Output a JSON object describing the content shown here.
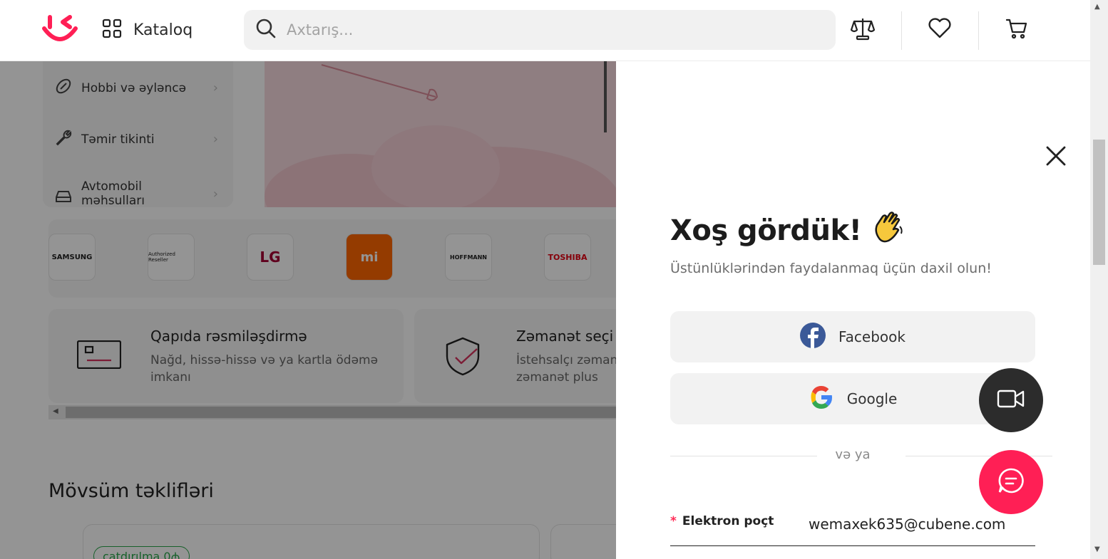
{
  "header": {
    "catalog_label": "Kataloq",
    "search_placeholder": "Axtarış..."
  },
  "background": {
    "categories": [
      {
        "label": "Hobbi və əyləncə"
      },
      {
        "label": "Təmir tikinti"
      },
      {
        "label": "Avtomobil məhsulları"
      }
    ],
    "brands": [
      "SAMSUNG",
      "Authorized Reseller",
      "LG",
      "mi",
      "HOFFMANN",
      "TOSHIBA"
    ],
    "features": [
      {
        "title": "Qapıda rəsmiləşdirmə",
        "desc": "Nağd, hissə-hissə və ya kartla ödəmə imkanı"
      },
      {
        "title": "Zəmanət seçi",
        "desc": "İstehsalçı zəman zəmanət plus"
      }
    ],
    "section_title": "Mövsüm təklifləri",
    "card_pill": "çatdırılma 0₼"
  },
  "login": {
    "title": "Xoş gördük!",
    "emoji": "👋",
    "subtitle": "Üstünlüklərindən faydalanmaq üçün daxil olun!",
    "facebook_label": "Facebook",
    "google_label": "Google",
    "divider_text": "və ya",
    "email_required_mark": "*",
    "email_label": "Elektron poçt",
    "email_value": "wemaxek635@cubene.com"
  },
  "colors": {
    "brand": "#ff1f55",
    "facebook": "#3b5998",
    "dark_fab": "#2c2c2c"
  }
}
